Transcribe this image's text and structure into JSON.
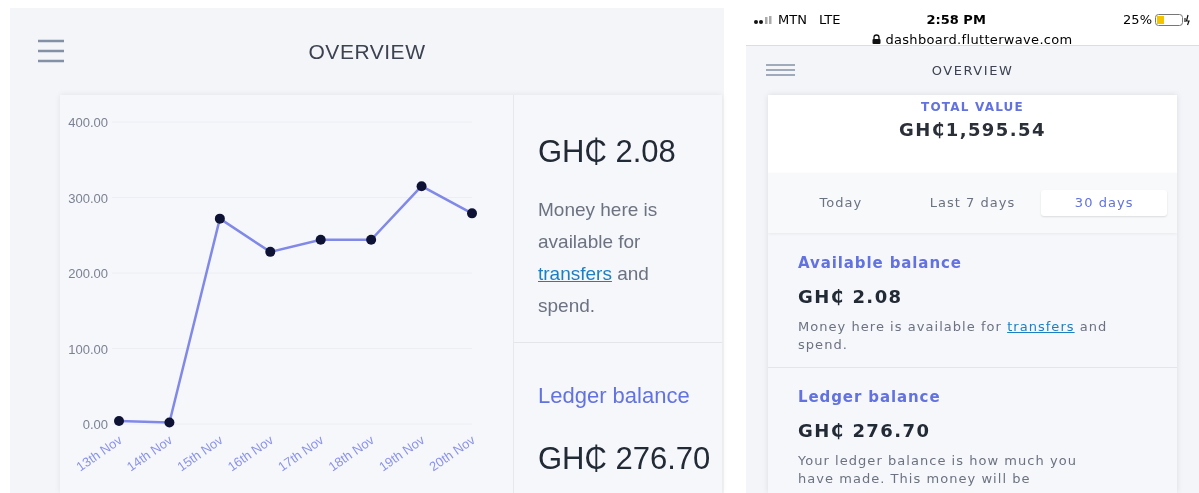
{
  "desktop_view": {
    "header": {
      "title": "OVERVIEW"
    },
    "chart_data": {
      "type": "line",
      "categories": [
        "13th Nov",
        "14th Nov",
        "15th Nov",
        "16th Nov",
        "17th Nov",
        "18th Nov",
        "19th Nov",
        "20th Nov"
      ],
      "values": [
        4,
        2,
        272,
        228,
        244,
        244,
        315,
        279
      ],
      "marker": true,
      "ylim": [
        0,
        400
      ],
      "yticks": [
        {
          "value": 0,
          "label": "0.00"
        },
        {
          "value": 100,
          "label": "100.00"
        },
        {
          "value": 200,
          "label": "200.00"
        },
        {
          "value": 300,
          "label": "300.00"
        },
        {
          "value": 400,
          "label": "400.00"
        }
      ]
    },
    "available_balance": {
      "amount": "GH₵ 2.08",
      "text_before": "Money here is available for",
      "link": "transfers",
      "text_after": "and spend."
    },
    "ledger_balance": {
      "label": "Ledger balance",
      "amount": "GH₵ 276.70"
    }
  },
  "mobile_view": {
    "status_bar": {
      "carrier": "MTN",
      "network": "LTE",
      "time": "2:58 PM",
      "battery": "25%",
      "url": "dashboard.flutterwave.com"
    },
    "header": {
      "title": "OVERVIEW"
    },
    "total": {
      "label": "TOTAL VALUE",
      "amount": "GH₵1,595.54"
    },
    "tabs": [
      {
        "label": "Today",
        "selected": false
      },
      {
        "label": "Last 7 days",
        "selected": false
      },
      {
        "label": "30 days",
        "selected": true
      }
    ],
    "available_balance": {
      "label": "Available balance",
      "amount": "GH₵ 2.08",
      "text_before": "Money here is available for",
      "link": "transfers",
      "text_after": "and spend."
    },
    "ledger_balance": {
      "label": "Ledger balance",
      "amount": "GH₵ 276.70",
      "description": "Your ledger balance is how much you have made. This money will be"
    }
  }
}
